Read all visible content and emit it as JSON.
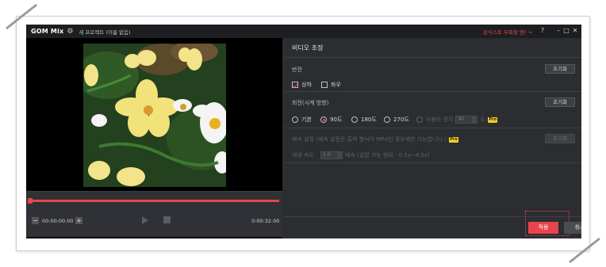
{
  "titlebar": {
    "logo": "GOM Mix",
    "project_title": "새 프로젝트 (이름 없음)",
    "promo_link": "공식스토 부족할 땐! →",
    "help": "?",
    "minimize": "–",
    "maximize": "□",
    "close": "✕"
  },
  "player": {
    "current_time": "00:00:00.00",
    "total_time": "0:00:32.00",
    "minus": "−",
    "plus": "+"
  },
  "settings": {
    "title": "비디오 조정",
    "flip": {
      "label": "반전",
      "reset": "초기화",
      "options": [
        {
          "label": "상하",
          "checked": true
        },
        {
          "label": "좌우",
          "checked": false
        }
      ]
    },
    "rotate": {
      "label": "회전(시계 방향)",
      "reset": "초기화",
      "options": [
        {
          "label": "기본",
          "selected": false
        },
        {
          "label": "90도",
          "selected": true
        },
        {
          "label": "180도",
          "selected": false
        },
        {
          "label": "270도",
          "selected": false
        },
        {
          "label": "사용자 정의",
          "selected": false
        }
      ],
      "custom_value": "90",
      "unit": "도",
      "pro": "Pro"
    },
    "speed": {
      "label": "배속 설정 (배속 설정은 출력 형식이 MP4인 경우에만 가능합니다.)",
      "pro": "Pro",
      "reset": "초기화",
      "playback_label": "재생 속도",
      "value": "1.0",
      "range_note": "배속 (설정 가능 범위 : 0.5x~4.0x)"
    },
    "apply": "적용",
    "cancel": "취소"
  }
}
